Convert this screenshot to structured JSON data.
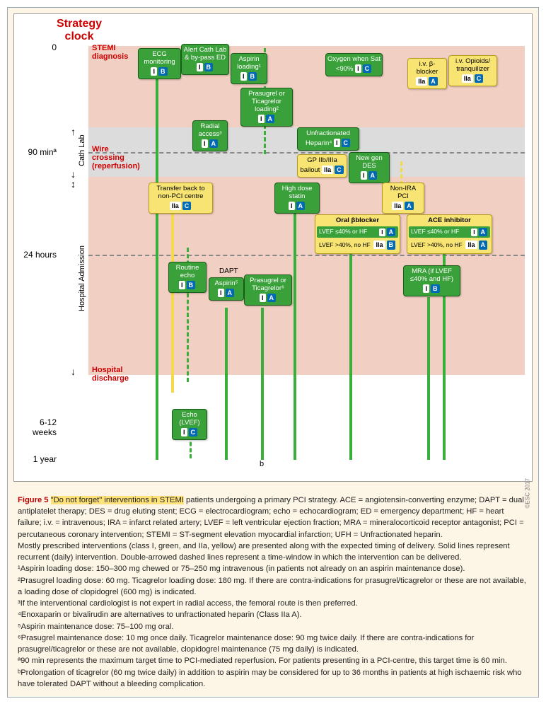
{
  "title_l1": "Strategy",
  "title_l2": "clock",
  "axis": {
    "t0": "0",
    "t90": "90 minª",
    "t24": "24 hours",
    "t612": "6-12 weeks",
    "t1y": "1 year"
  },
  "rows": {
    "stemi": "STEMI diagnosis",
    "wire": "Wire crossing (reperfusion)",
    "discharge": "Hospital discharge"
  },
  "phases": {
    "cath": "Cath Lab",
    "hosp": "Hospital Admission"
  },
  "note_b": "b",
  "esc": "©ESC 2017",
  "boxes": {
    "ecg": "ECG monitoring",
    "ecg_cl": "I",
    "ecg_loe": "B",
    "alert": "Alert Cath Lab & by-pass ED",
    "alert_cl": "I",
    "alert_loe": "B",
    "asp": "Aspirin loading¹",
    "asp_cl": "I",
    "asp_loe": "B",
    "o2": "Oxygen when Sat <90%",
    "o2_cl": "I",
    "o2_loe": "C",
    "bblock": "i.v. β-blocker",
    "bblock_cl": "IIa",
    "bblock_loe": "A",
    "opio": "i.v. Opioids/ tranquilizer",
    "opio_cl": "IIa",
    "opio_loe": "C",
    "pras": "Prasugrel or Ticagrelor loading²",
    "pras_cl": "I",
    "pras_loe": "A",
    "radial": "Radial access³",
    "radial_cl": "I",
    "radial_loe": "A",
    "ufh": "Unfractionated Heparin⁴",
    "ufh_cl": "I",
    "ufh_loe": "C",
    "gp": "GP IIb/IIIa bailout",
    "gp_cl": "IIa",
    "gp_loe": "C",
    "des": "New gen DES",
    "des_cl": "I",
    "des_loe": "A",
    "nonira": "Non-IRA PCI",
    "nonira_cl": "IIa",
    "nonira_loe": "A",
    "transfer": "Transfer back to non-PCI centre",
    "transfer_cl": "IIa",
    "transfer_loe": "C",
    "statin": "High dose statin",
    "statin_cl": "I",
    "statin_loe": "A",
    "oralb": "Oral βblocker",
    "oralb_c1": "LVEF ≤40% or HF",
    "oralb_c1_cl": "I",
    "oralb_c1_loe": "A",
    "oralb_c2": "LVEF >40%, no HF",
    "oralb_c2_cl": "IIa",
    "oralb_c2_loe": "B",
    "ace": "ACE inhibitor",
    "ace_c1": "LVEF ≤40% or HF",
    "ace_c1_cl": "I",
    "ace_c1_loe": "A",
    "ace_c2": "LVEF >40%, no HF",
    "ace_c2_cl": "IIa",
    "ace_c2_loe": "A",
    "routine": "Routine echo",
    "routine_cl": "I",
    "routine_loe": "B",
    "dapt": "DAPT",
    "asp5": "Aspirin⁵",
    "asp5_cl": "I",
    "asp5_loe": "A",
    "pras6": "Prasugrel or Ticagrelor⁶",
    "pras6_cl": "I",
    "pras6_loe": "A",
    "mra": "MRA (if LVEF ≤40% and HF)",
    "mra_cl": "I",
    "mra_loe": "B",
    "echo_lv": "Echo (LVEF)",
    "echo_lv_cl": "I",
    "echo_lv_loe": "C"
  },
  "caption": {
    "fig": "Figure 5",
    "hl": "\"Do not forget\" interventions in STEMI",
    "main": " patients undergoing a primary PCI strategy. ACE = angiotensin-converting enzyme; DAPT = dual antiplatelet therapy; DES = drug eluting stent; ECG = electrocardiogram; echo = echocardiogram; ED = emergency department; HF = heart failure; i.v. = intravenous; IRA = infarct related artery; LVEF = left ventricular ejection fraction; MRA = mineralocorticoid receptor antagonist; PCI = percutaneous coronary intervention; STEMI = ST-segment elevation myocardial infarction; UFH = Unfractionated heparin.",
    "p2": "Mostly prescribed interventions (class I, green, and IIa, yellow) are presented along with the expected timing of delivery. Solid lines represent recurrent (daily) intervention. Double-arrowed dashed lines represent a time-window in which the intervention can be delivered.",
    "f1": "¹Aspirin loading dose: 150–300 mg chewed or 75–250 mg intravenous (in patients not already on an aspirin maintenance dose).",
    "f2": "²Prasugrel loading dose: 60 mg. Ticagrelor loading dose: 180 mg. If there are contra-indications for prasugrel/ticagrelor or these are not available, a loading dose of clopidogrel (600 mg) is indicated.",
    "f3": "³If the interventional cardiologist is not expert in radial access, the femoral route is then preferred.",
    "f4": "⁴Enoxaparin or bivalirudin are alternatives to unfractionated heparin (Class IIa A).",
    "f5": "⁵Aspirin maintenance dose: 75–100 mg oral.",
    "f6": "⁶Prasugrel maintenance dose: 10 mg once daily. Ticagrelor maintenance dose: 90 mg twice daily. If there are contra-indications for prasugrel/ticagrelor or these are not available, clopidogrel maintenance (75 mg daily) is indicated.",
    "fa": "ª90 min represents the maximum target time to PCI-mediated reperfusion. For patients presenting in a PCI-centre, this target time is 60 min.",
    "fb": "ᵇProlongation of ticagrelor (60 mg twice daily) in addition to aspirin may be considered for up to 36 months in patients at high ischaemic risk who have tolerated DAPT without a bleeding complication."
  }
}
